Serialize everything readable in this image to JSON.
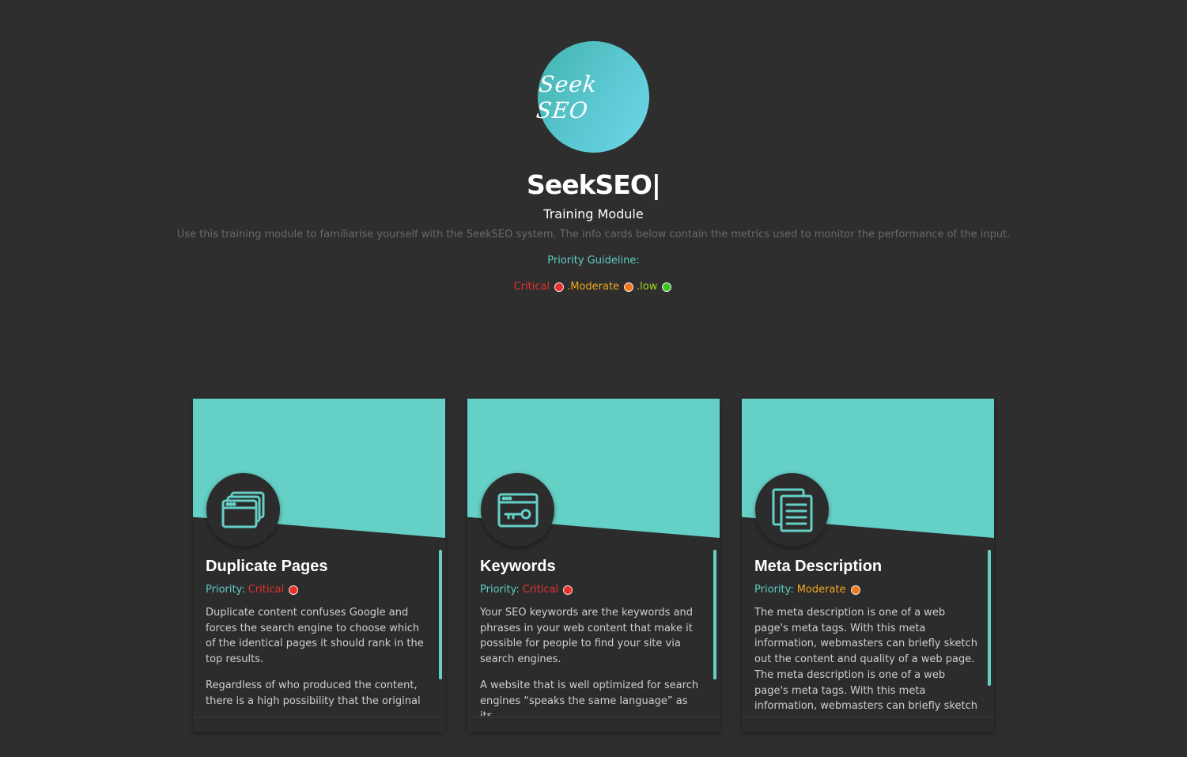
{
  "header": {
    "logo_text": "Seek SEO",
    "title": "SeekSEO|",
    "subtitle": "Training Module",
    "description": "Use this training module to familiarise yourself with the SeekSEO system. The info cards below contain the metrics used to monitor the performance of the input.",
    "guideline_title": "Priority Guideline:"
  },
  "legend": [
    {
      "label": "Critical",
      "color": "#e8312d"
    },
    {
      "label": ".Moderate",
      "color": "#f0781e",
      "text_color": "#f0a81e"
    },
    {
      "label": ".low",
      "color": "#41c424",
      "text_color": "#a6d51d"
    }
  ],
  "cards": [
    {
      "icon": "browser-windows-icon",
      "title": "Duplicate Pages",
      "priority_label": "Priority:",
      "priority_value": "Critical",
      "priority_color": "#e8312d",
      "paragraphs": [
        "Duplicate content confuses Google and forces the search engine to choose which of the identical pages it should rank in the top results.",
        "Regardless of who produced the content, there is a high possibility that the original"
      ]
    },
    {
      "icon": "browser-key-icon",
      "title": "Keywords",
      "priority_label": "Priority:",
      "priority_value": "Critical",
      "priority_color": "#e8312d",
      "paragraphs": [
        "Your SEO keywords are the keywords and phrases in your web content that make it possible for people to find your site via search engines.",
        "A website that is well optimized for search engines “speaks the same language” as its"
      ]
    },
    {
      "icon": "documents-icon",
      "title": "Meta Description",
      "priority_label": "Priority:",
      "priority_value": "Moderate",
      "priority_color": "#f0781e",
      "priority_text_color": "#f0a81e",
      "paragraphs": [
        "The meta description is one of a web page's meta tags. With this meta information, webmasters can briefly sketch out the content and quality of a web page. The meta description is one of a web page's meta tags. With this meta information, webmasters can briefly sketch out the content and quality of"
      ]
    }
  ]
}
